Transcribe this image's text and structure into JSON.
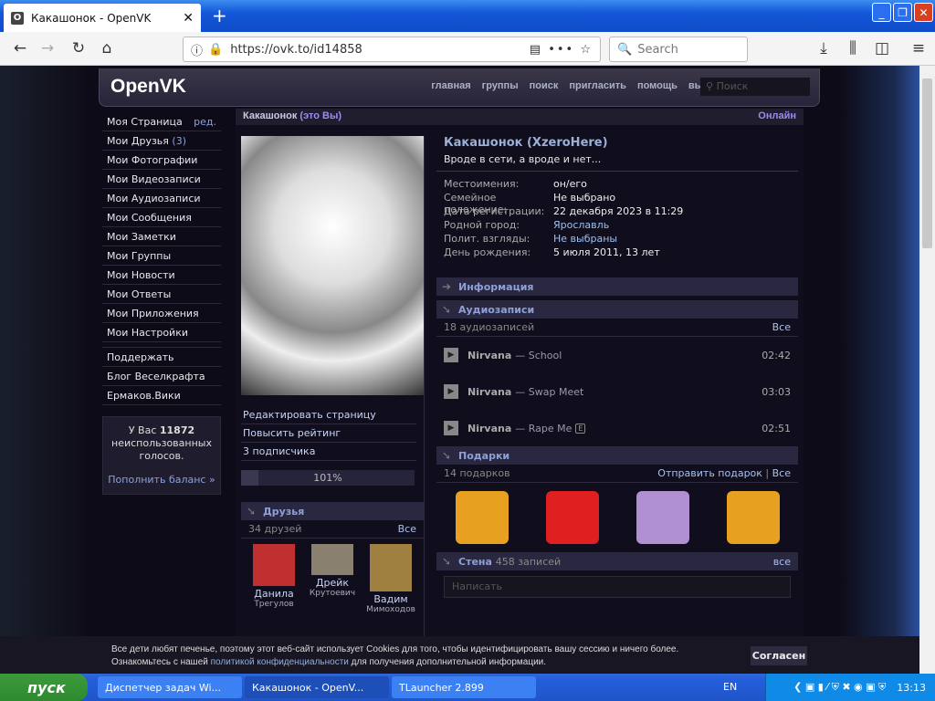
{
  "browser": {
    "tab_title": "Какашонок - OpenVK",
    "url": "https://ovk.to/id14858",
    "search_placeholder": "Search"
  },
  "header": {
    "logo": "OpenVK",
    "nav": [
      "главная",
      "группы",
      "поиск",
      "пригласить",
      "помощь",
      "выйти"
    ],
    "search_placeholder": "Поиск"
  },
  "sidebar": {
    "items": [
      {
        "label": "Моя Страница",
        "extra": "ред."
      },
      {
        "label": "Мои Друзья",
        "extra": "(3)"
      },
      {
        "label": "Мои Фотографии"
      },
      {
        "label": "Мои Видеозаписи"
      },
      {
        "label": "Мои Аудиозаписи"
      },
      {
        "label": "Мои Сообщения"
      },
      {
        "label": "Мои Заметки"
      },
      {
        "label": "Мои Группы"
      },
      {
        "label": "Мои Новости"
      },
      {
        "label": "Мои Ответы"
      },
      {
        "label": "Мои Приложения"
      },
      {
        "label": "Мои Настройки"
      }
    ],
    "links": [
      "Поддержать",
      "Блог Веселкрафта",
      "Ермаков.Вики"
    ],
    "votes": {
      "prefix": "У Вас",
      "count": "11872",
      "suffix": "неиспользованных голосов.",
      "link": "Пополнить баланс »"
    }
  },
  "main": {
    "name": "Какашонок",
    "me": "(это Вы)",
    "online": "Онлайн",
    "menu": [
      "Редактировать страницу",
      "Повысить рейтинг",
      "3 подписчика"
    ],
    "rating": {
      "label": "101%",
      "value": 101
    },
    "friends": {
      "title": "Друзья",
      "count": "34 друзей",
      "all": "Все",
      "list": [
        {
          "first": "Данила",
          "last": "Трегулов",
          "color": "#c03030"
        },
        {
          "first": "Дрейк",
          "last": "Крутоевич",
          "color": "#8a8070"
        },
        {
          "first": "Вадим",
          "last": "Мимоходов",
          "color": "#a08040"
        }
      ]
    },
    "profile": {
      "full_name": "Какашонок (XzeroHere)",
      "status": "Вроде в сети, а вроде и нет...",
      "info": [
        {
          "k": "Местоимения:",
          "v": "он/его"
        },
        {
          "k": "Семейное положение:",
          "v": "Не выбрано"
        },
        {
          "k": "Дата регистрации:",
          "v": "22 декабря 2023 в 11:29"
        },
        {
          "k": "Родной город:",
          "v": "Ярославль",
          "link": true
        },
        {
          "k": "Полит. взгляды:",
          "v": "Не выбраны",
          "link": true
        },
        {
          "k": "День рождения:",
          "v": "5 июля 2011, 13 лет"
        }
      ]
    },
    "info_title": "Информация",
    "audio": {
      "title": "Аудиозаписи",
      "count": "18 аудиозаписей",
      "all": "Все",
      "tracks": [
        {
          "artist": "Nirvana",
          "title": "School",
          "dur": "02:42"
        },
        {
          "artist": "Nirvana",
          "title": "Swap Meet",
          "dur": "03:03"
        },
        {
          "artist": "Nirvana",
          "title": "Rape Me",
          "dur": "02:51",
          "explicit": "E"
        }
      ]
    },
    "gifts": {
      "title": "Подарки",
      "count": "14 подарков",
      "send": "Отправить подарок",
      "all": "Все",
      "colors": [
        "#e8a020",
        "#e02020",
        "#b090d0",
        "#e8a020"
      ]
    },
    "wall": {
      "title": "Стена",
      "count": "458 записей",
      "all": "все",
      "placeholder": "Написать"
    }
  },
  "cookie": {
    "line1": "Все дети любят печенье, поэтому этот веб-сайт использует Cookies для того, чтобы идентифицировать вашу сессию и ничего более.",
    "line2a": "Ознакомьтесь с нашей",
    "link": "политикой конфиденциальности",
    "line2b": "для получения дополнительной информации.",
    "button": "Согласен"
  },
  "taskbar": {
    "start": "пуск",
    "tasks": [
      "Диспетчер задач Wi...",
      "Какашонок - OpenV...",
      "TLauncher 2.899"
    ],
    "lang": "EN",
    "clock": "13:13"
  }
}
